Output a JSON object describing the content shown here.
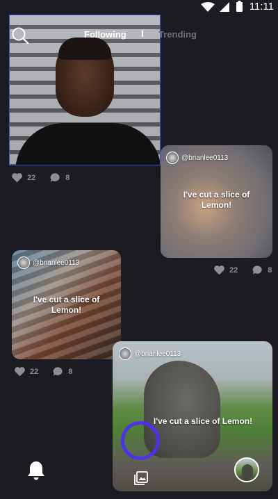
{
  "status_bar": {
    "time": "11:11"
  },
  "header": {
    "tabs": [
      {
        "label": "Following"
      },
      {
        "label": "Trending"
      }
    ],
    "separator": "I"
  },
  "posts": [
    {
      "likes": "22",
      "comments": "8"
    },
    {
      "username": "@brianlee0113",
      "caption": "I've cut a slice of Lemon!",
      "likes": "22",
      "comments": "8"
    },
    {
      "username": "@brianlee0113",
      "caption": "I've cut a slice of Lemon!",
      "likes": "22",
      "comments": "8"
    },
    {
      "username": "@brianlee0113",
      "caption": "I've cut a slice of Lemon!"
    }
  ],
  "icons": {
    "search": "search-icon",
    "heart": "heart-icon",
    "comment": "comment-icon",
    "bell": "bell-icon",
    "gallery": "gallery-icon"
  },
  "colors": {
    "background": "#1c1b21",
    "accent_ring": "#4d33e6",
    "selection_border": "#3a55d6",
    "muted_text": "#8f8e94"
  }
}
